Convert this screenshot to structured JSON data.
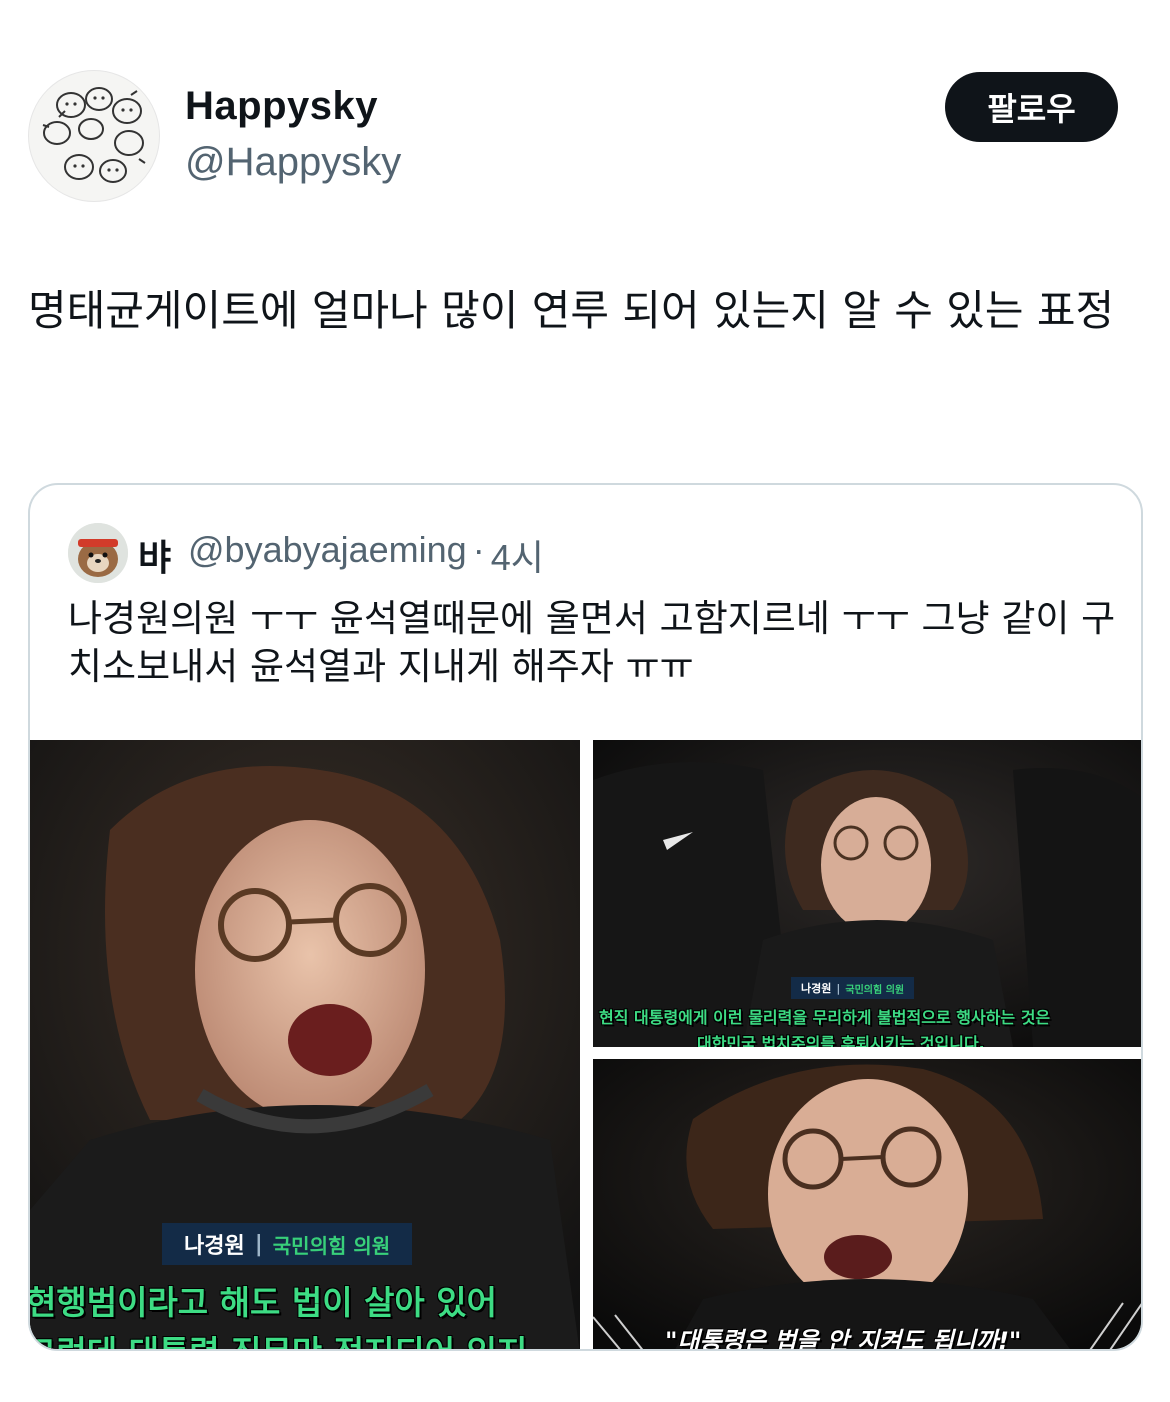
{
  "author": {
    "display_name": "Happysky",
    "handle": "@Happysky",
    "avatar_icon": "cartoon-animals-avatar"
  },
  "follow_button": {
    "label": "팔로우"
  },
  "tweet": {
    "text": "명태균게이트에 얼마나 많이 연루 되어 있는지 알 수 있는 표정"
  },
  "quote": {
    "display_name": "뱌",
    "handle": "@byabyajaeming",
    "separator": "·",
    "time": "4시",
    "text": "나경원의원 ㅜㅜ 윤석열때문에 울면서 고함지르네 ㅜㅜ 그냥 같이 구치소보내서 윤석열과 지내게 해주자 ㅠㅠ",
    "media": [
      {
        "name_plate": {
          "name": "나경원",
          "sep": "|",
          "role": "국민의힘 의원"
        },
        "captions": [
          "현행범이라고 해도 법이 살아 있어",
          "그런데 대통령 직무만 정지되어 있지"
        ]
      },
      {
        "name_plate": {
          "name": "나경원",
          "sep": "|",
          "role": "국민의힘 의원"
        },
        "captions": [
          "현직 대통령에게 이런 물리력을 무리하게 불법적으로 행사하는 것은",
          "대한민국 법치주의를 후퇴시키는 것입니다."
        ]
      },
      {
        "quote_caption": "\"대통령은 법을 안 지켜도 됩니까!\""
      }
    ]
  },
  "colors": {
    "text_primary": "#0f1419",
    "text_secondary": "#536471",
    "border": "#cfd9de",
    "button_bg": "#0f1419",
    "caption_green": "#3ddc84"
  }
}
